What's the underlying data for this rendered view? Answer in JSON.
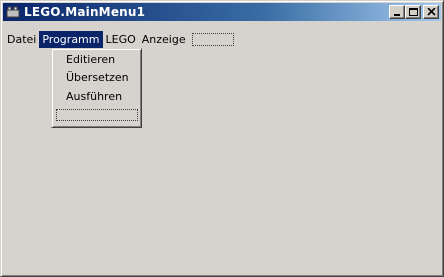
{
  "window": {
    "title": "LEGO.MainMenu1",
    "icon": "lego-app-icon",
    "controls": [
      "minimize-icon",
      "maximize-icon",
      "close-icon"
    ]
  },
  "menubar": {
    "items": [
      {
        "label": "Datei",
        "active": false
      },
      {
        "label": "Programm",
        "active": true
      },
      {
        "label": "LEGO",
        "active": false
      },
      {
        "label": "Anzeige",
        "active": false
      }
    ]
  },
  "dropdown": {
    "items": [
      {
        "label": "Editieren"
      },
      {
        "label": "Übersetzen"
      },
      {
        "label": "Ausführen"
      }
    ]
  },
  "colors": {
    "titlebar_start": "#0a246a",
    "titlebar_end": "#a6caf0",
    "face": "#d6d3ce",
    "highlight": "#0a246a"
  }
}
